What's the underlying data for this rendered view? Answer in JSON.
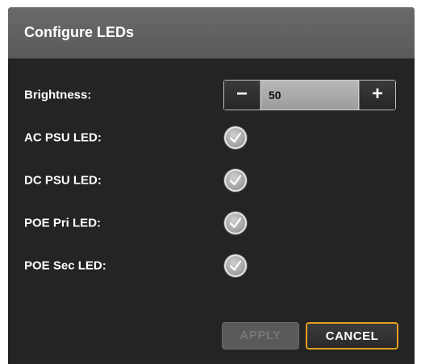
{
  "dialog": {
    "title": "Configure LEDs"
  },
  "brightness": {
    "label": "Brightness:",
    "decrement_label": "−",
    "value": "50",
    "increment_label": "+"
  },
  "leds": [
    {
      "label": "AC PSU LED:",
      "checked": true
    },
    {
      "label": "DC PSU LED:",
      "checked": true
    },
    {
      "label": "POE Pri LED:",
      "checked": true
    },
    {
      "label": "POE Sec LED:",
      "checked": true
    }
  ],
  "buttons": {
    "apply_label": "APPLY",
    "apply_enabled": false,
    "cancel_label": "CANCEL"
  },
  "colors": {
    "dialog_bg": "#242424",
    "titlebar_bg": "#5f5f5f",
    "focus_accent": "#e0a020"
  },
  "icons": {
    "checkbox": "checkmark-circle-icon"
  }
}
